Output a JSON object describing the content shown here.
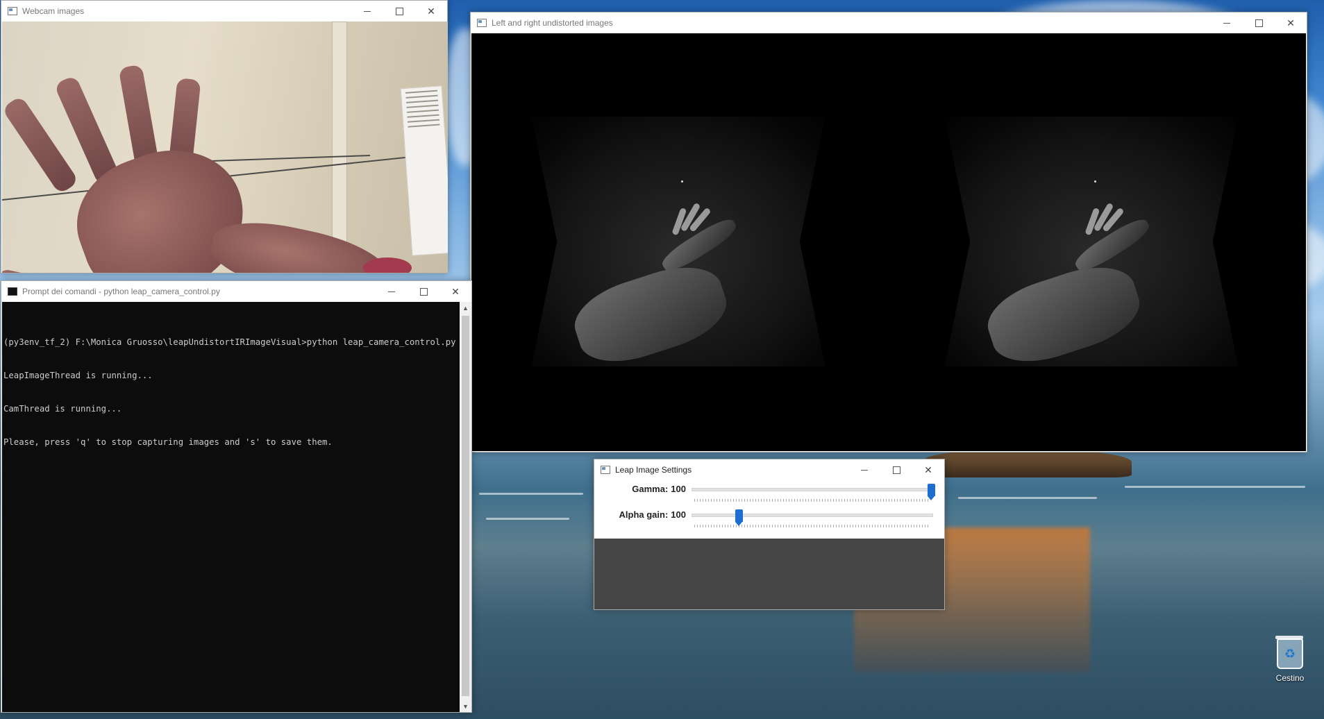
{
  "windows": {
    "webcam": {
      "title": "Webcam images"
    },
    "stereo": {
      "title": "Left and right undistorted images"
    },
    "cmd": {
      "title": "Prompt dei comandi - python  leap_camera_control.py",
      "lines": [
        "(py3env_tf_2) F:\\Monica Gruosso\\leapUndistortIRImageVisual>python leap_camera_control.py",
        "LeapImageThread is running...",
        "CamThread is running...",
        "Please, press 'q' to stop capturing images and 's' to save them."
      ]
    },
    "settings": {
      "title": "Leap Image Settings",
      "trackbars": [
        {
          "label": "Gamma:",
          "value": "100",
          "position": 1.0
        },
        {
          "label": "Alpha gain:",
          "value": "100",
          "position": 0.2
        }
      ]
    }
  },
  "desktop": {
    "recycle_bin_label": "Cestino"
  },
  "icons": {
    "minimize": "minimize-icon",
    "maximize": "maximize-icon",
    "close": "close-icon",
    "recycle_bin": "recycle-bin-icon"
  }
}
